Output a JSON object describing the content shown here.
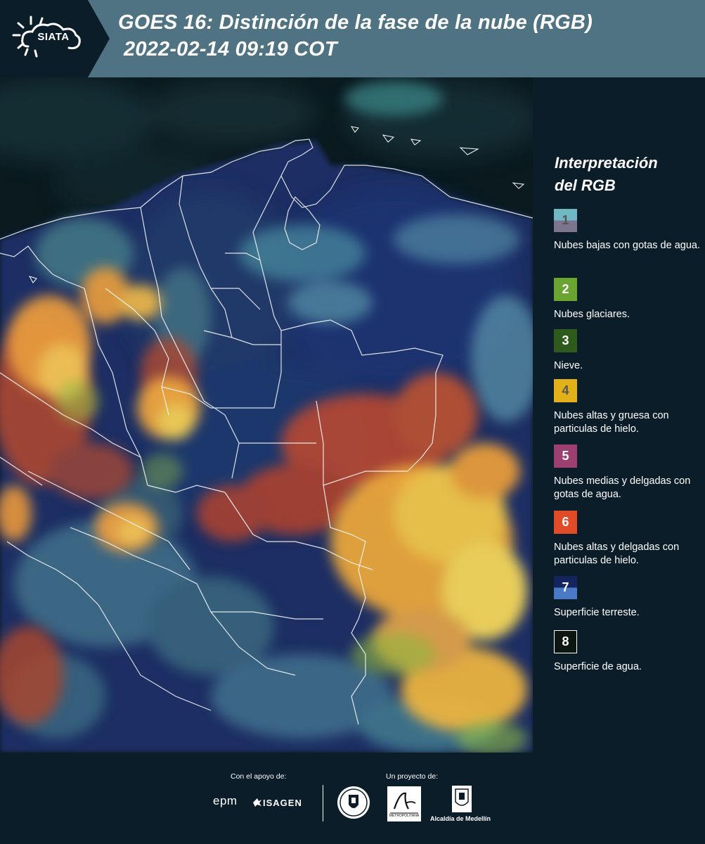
{
  "header": {
    "logo_text": "SIATA",
    "title_line1": "GOES 16: Distinción de la fase de la nube (RGB)",
    "title_line2": "2022-02-14 09:19 COT"
  },
  "legend": {
    "title_line1": "Interpretación",
    "title_line2": "del RGB",
    "items": [
      {
        "number": "1",
        "description": "Nubes bajas con gotas de agua.",
        "color_top": "#6fb8c4",
        "color_bottom": "#7b7590",
        "text_color": "#555555"
      },
      {
        "number": "2",
        "description": "Nubes glaciares.",
        "color_top": "#6aa531",
        "color_bottom": "#6aa531",
        "text_color": "#ffffff"
      },
      {
        "number": "3",
        "description": "Nieve.",
        "color_top": "#2e5b1c",
        "color_bottom": "#2e5b1c",
        "text_color": "#ffffff"
      },
      {
        "number": "4",
        "description": "Nubes altas y gruesa con particulas de hielo.",
        "color_top": "#e2b019",
        "color_bottom": "#e2b019",
        "text_color": "#555555"
      },
      {
        "number": "5",
        "description": "Nubes medias y delgadas con gotas de agua.",
        "color_top": "#9c4072",
        "color_bottom": "#9c4072",
        "text_color": "#ffffff"
      },
      {
        "number": "6",
        "description": "Nubes altas y delgadas con particulas de hielo.",
        "color_top": "#e14b28",
        "color_bottom": "#e14b28",
        "text_color": "#ffffff"
      },
      {
        "number": "7",
        "description": "Superficie terreste.",
        "color_top": "#13245e",
        "color_bottom": "#4a79c6",
        "text_color": "#ffffff"
      },
      {
        "number": "8",
        "description": "Superficie de agua.",
        "color_top": "#0b1710",
        "color_bottom": "#0b1710",
        "text_color": "#ffffff"
      }
    ]
  },
  "footer": {
    "support_label": "Con el apoyo de:",
    "project_label": "Un proyecto de:",
    "sponsor_epm": "epm",
    "sponsor_isagen": "ISAGEN",
    "alcaldia": "Alcaldía de Medellín",
    "metropolitana": "METROPOLITANA"
  }
}
